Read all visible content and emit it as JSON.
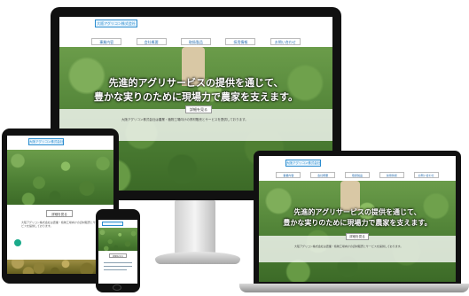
{
  "site": {
    "logo": "大阪アグリコン株式会社",
    "nav": [
      "事業内容",
      "会社概要",
      "取扱製品",
      "採用情報",
      "お問い合わせ"
    ],
    "hero_line1": "先進的アグリサービスの提供を通じて、",
    "hero_line2": "豊かな実りのために現場力で農家を支えます。",
    "cta_label": "詳細を見る",
    "intro_text": "大阪アグリコン株式会社は農業・植物工場向けの資材販売とサービスを提供しております。"
  },
  "colors": {
    "accent": "#2a8ccf",
    "leaf": "#5d8f3e",
    "bezel": "#111111"
  }
}
